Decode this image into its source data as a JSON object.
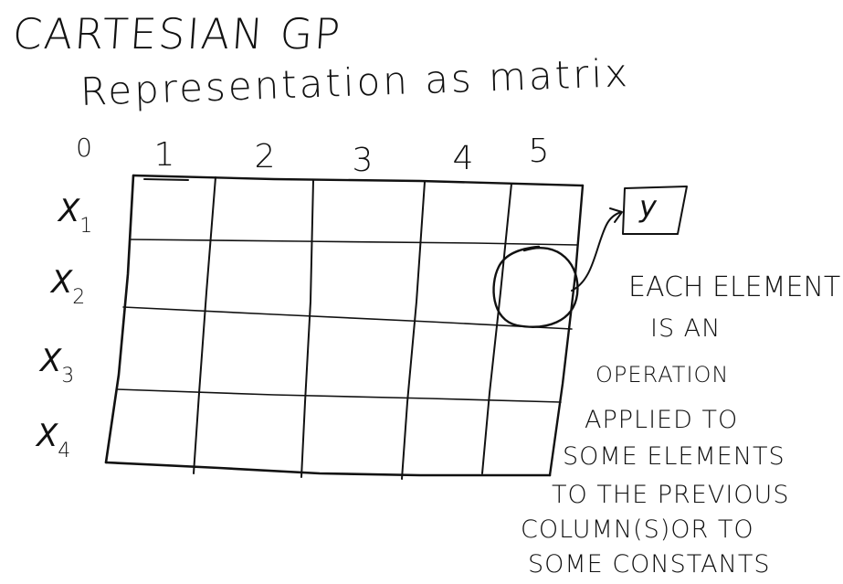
{
  "title": "CARTESIAN GP",
  "subtitle": "Representation as matrix",
  "columns": [
    "0",
    "1",
    "2",
    "3",
    "4",
    "5"
  ],
  "rows": [
    {
      "base": "X",
      "index": "1"
    },
    {
      "base": "X",
      "index": "2"
    },
    {
      "base": "X",
      "index": "3"
    },
    {
      "base": "X",
      "index": "4"
    }
  ],
  "output": {
    "label": "y"
  },
  "note": [
    "EACH ELEMENT",
    "IS AN",
    "OPERATION",
    "APPLIED TO",
    "SOME ELEMENTS",
    "TO THE PREVIOUS",
    "COLUMN(S)OR TO",
    "SOME CONSTANTS"
  ],
  "ink_color": "#111111"
}
